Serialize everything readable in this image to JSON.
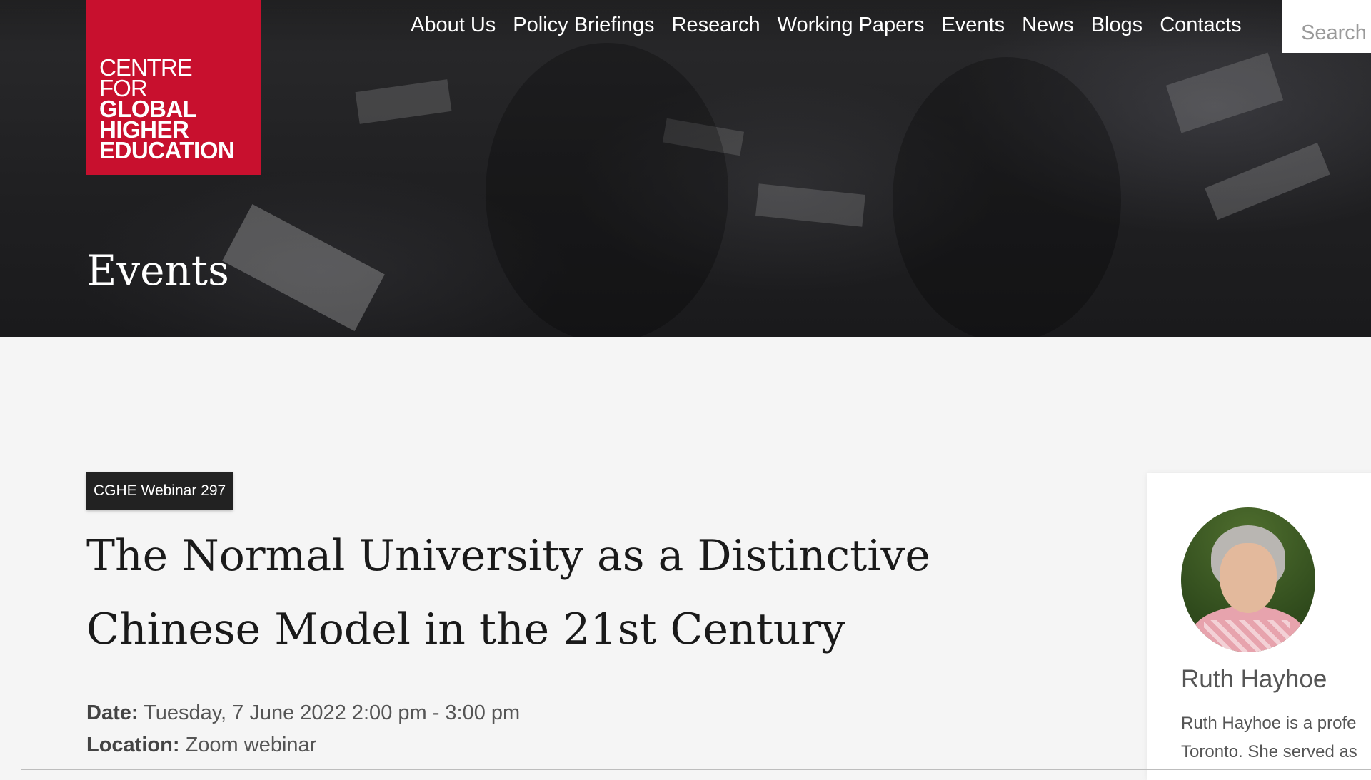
{
  "logo": {
    "line1": "CENTRE",
    "line2": "FOR",
    "line3": "GLOBAL",
    "line4": "HIGHER",
    "line5": "EDUCATION"
  },
  "nav": {
    "items": [
      {
        "label": "About Us"
      },
      {
        "label": "Policy Briefings"
      },
      {
        "label": "Research"
      },
      {
        "label": "Working Papers"
      },
      {
        "label": "Events"
      },
      {
        "label": "News"
      },
      {
        "label": "Blogs"
      },
      {
        "label": "Contacts"
      }
    ]
  },
  "search": {
    "placeholder": "Search"
  },
  "hero": {
    "title": "Events"
  },
  "event": {
    "badge": "CGHE Webinar 297",
    "title_line1": "The Normal University as a Distinctive",
    "title_line2": "Chinese Model in the 21st Century",
    "date_label": "Date:",
    "date_value": "Tuesday, 7 June 2022 2:00 pm - 3:00 pm",
    "location_label": "Location:",
    "location_value": "Zoom webinar"
  },
  "speaker": {
    "name": "Ruth Hayhoe",
    "bio_line1": "Ruth Hayhoe is a profe",
    "bio_line2": "Toronto. She served as"
  },
  "colors": {
    "brand_red": "#c8102e",
    "badge_bg": "#222222",
    "hero_dark": "#1f1f21"
  }
}
